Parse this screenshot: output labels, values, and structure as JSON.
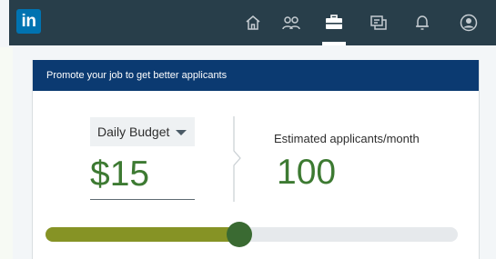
{
  "topbar": {
    "logo_text": "in",
    "nav": [
      {
        "icon": "home-icon"
      },
      {
        "icon": "my-network-icon"
      },
      {
        "icon": "jobs-briefcase-icon",
        "active": true
      },
      {
        "icon": "messaging-icon"
      },
      {
        "icon": "notifications-bell-icon"
      },
      {
        "icon": "profile-avatar-icon"
      }
    ]
  },
  "card": {
    "title": "Promote your job to get better applicants",
    "budget": {
      "select_label": "Daily Budget",
      "value": "$15"
    },
    "estimate": {
      "label": "Estimated applicants/month",
      "value": "100"
    },
    "slider": {
      "level_fraction": 0.47
    }
  },
  "colors": {
    "topbar": "#283e4a",
    "header": "#0b3a71",
    "accent_green": "#3d7a32",
    "slider_fill": "#869325",
    "slider_handle": "#3a6a32"
  }
}
